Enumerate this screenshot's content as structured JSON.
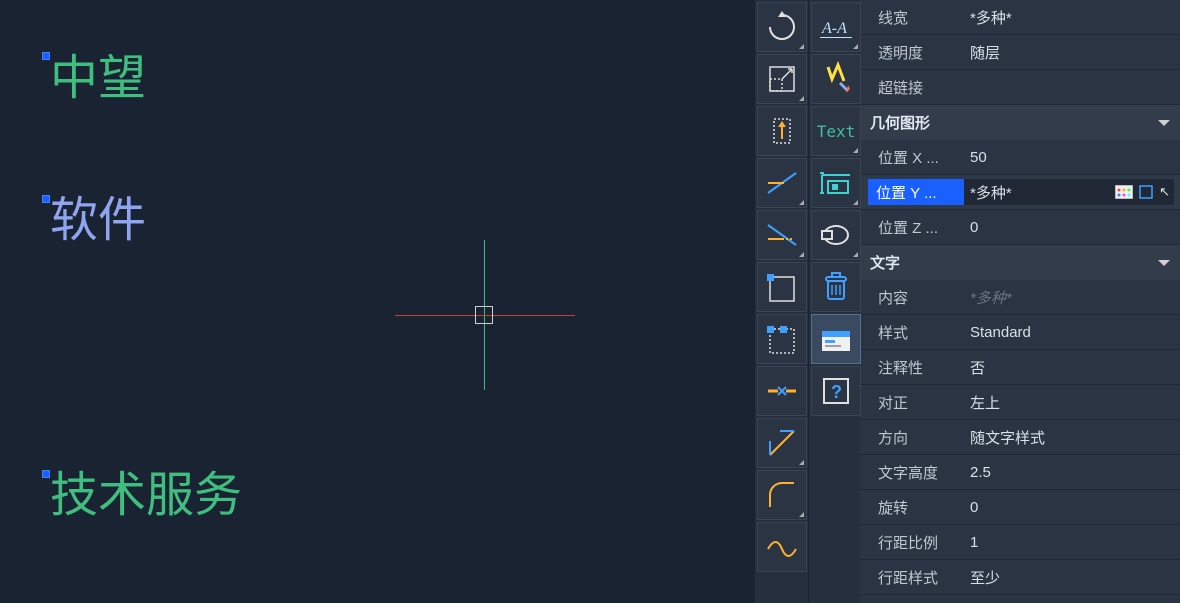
{
  "canvas": {
    "text1": "中望",
    "text2": "软件",
    "text3": "技术服务"
  },
  "text_tool_label": "Text",
  "props": {
    "general": {
      "lineweight_label": "线宽",
      "lineweight_value": "*多种*",
      "transparency_label": "透明度",
      "transparency_value": "随层",
      "hyperlink_label": "超链接",
      "hyperlink_value": ""
    },
    "geometry_header": "几何图形",
    "geometry": {
      "posx_label": "位置 X ...",
      "posx_value": "50",
      "posy_label": "位置 Y ...",
      "posy_value": "*多种*",
      "posz_label": "位置 Z ...",
      "posz_value": "0"
    },
    "text_header": "文字",
    "text": {
      "content_label": "内容",
      "content_value": "*多种*",
      "style_label": "样式",
      "style_value": "Standard",
      "annotative_label": "注释性",
      "annotative_value": "否",
      "justify_label": "对正",
      "justify_value": "左上",
      "direction_label": "方向",
      "direction_value": "随文字样式",
      "height_label": "文字高度",
      "height_value": "2.5",
      "rotation_label": "旋转",
      "rotation_value": "0",
      "linespacing_label": "行距比例",
      "linespacing_value": "1",
      "linespacestyle_label": "行距样式",
      "linespacestyle_value": "至少"
    }
  }
}
